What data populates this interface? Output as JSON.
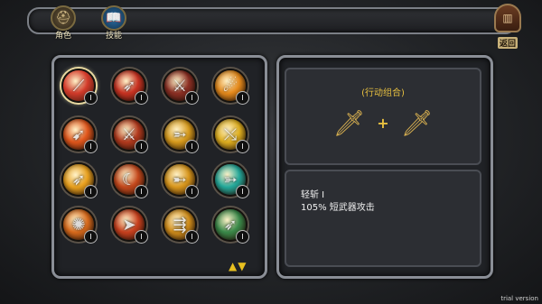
{
  "header": {
    "tabs": [
      {
        "label": "角色",
        "icon": "helmet-icon"
      },
      {
        "label": "技能",
        "icon": "spellbook-icon"
      }
    ],
    "back_label": "返回",
    "back_icon": "door-icon"
  },
  "skills": {
    "rows": [
      [
        {
          "icon": "claw-slash-icon",
          "rank": "I",
          "color": "#d23a2a",
          "selected": true
        },
        {
          "icon": "arrow-volley-icon",
          "rank": "I",
          "color": "#c83222"
        },
        {
          "icon": "blade-strike-icon",
          "rank": "I",
          "color": "#8c2f24"
        },
        {
          "icon": "fire-sweep-icon",
          "rank": "I",
          "color": "#e58a1c"
        }
      ],
      [
        {
          "icon": "flame-slash-icon",
          "rank": "I",
          "color": "#e0561c"
        },
        {
          "icon": "twin-dagger-icon",
          "rank": "I",
          "color": "#b23a1e"
        },
        {
          "icon": "piercing-thrust-icon",
          "rank": "I",
          "color": "#d69a1c"
        },
        {
          "icon": "spear-thrust-icon",
          "rank": "I",
          "color": "#e0b020"
        }
      ],
      [
        {
          "icon": "gust-slash-icon",
          "rank": "I",
          "color": "#e8a01e"
        },
        {
          "icon": "crescent-blade-icon",
          "rank": "I",
          "color": "#c4481c"
        },
        {
          "icon": "dagger-throw-icon",
          "rank": "I",
          "color": "#d8961c"
        },
        {
          "icon": "bow-shot-icon",
          "rank": "I",
          "color": "#23a89a"
        }
      ],
      [
        {
          "icon": "whirlwind-icon",
          "rank": "I",
          "color": "#d86a1c"
        },
        {
          "icon": "lunge-icon",
          "rank": "I",
          "color": "#c8401e"
        },
        {
          "icon": "spear-volley-icon",
          "rank": "I",
          "color": "#d4901c"
        },
        {
          "icon": "poison-arrow-icon",
          "rank": "I",
          "color": "#3a8a4a"
        }
      ]
    ],
    "scroll_up_icon": "triangle-up-icon",
    "scroll_down_icon": "triangle-down-icon"
  },
  "detail": {
    "combo_title": "(行动组合)",
    "combo_weapons": [
      "short-sword-icon",
      "short-sword-icon"
    ],
    "plus_symbol": "+",
    "skill_name": "轻斩 I",
    "skill_desc": "105% 短武器攻击"
  },
  "watermark": "trial version"
}
